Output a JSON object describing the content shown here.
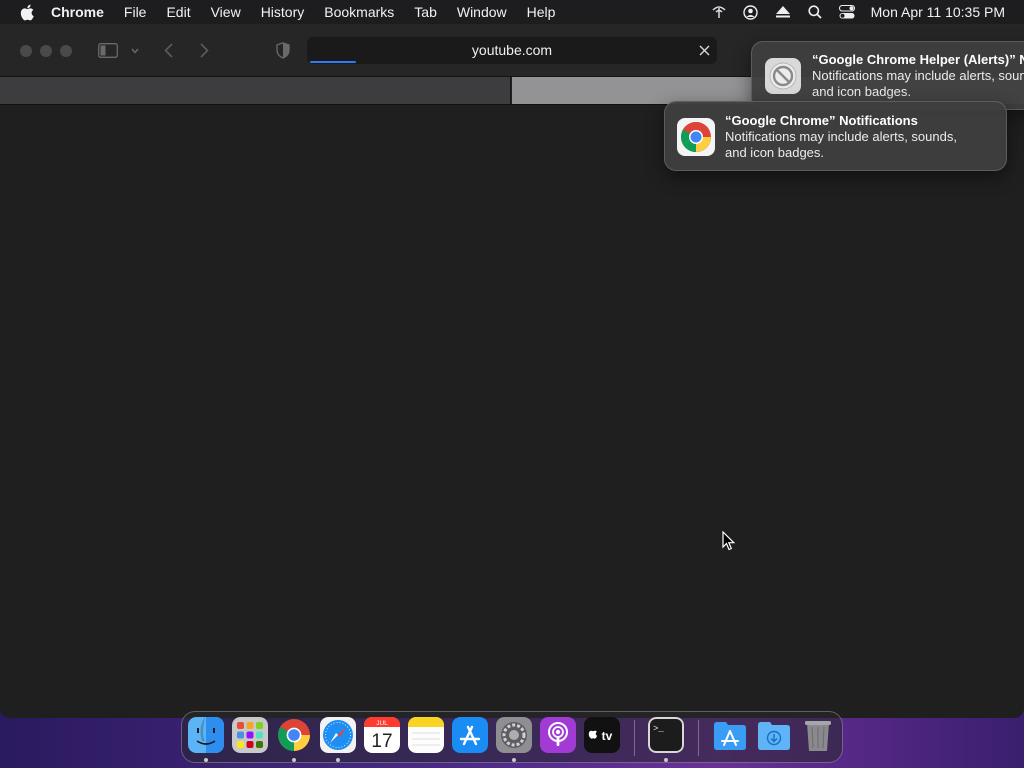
{
  "menubar": {
    "apple_icon": "apple-logo-icon",
    "app_name": "Chrome",
    "items": [
      "File",
      "Edit",
      "View",
      "History",
      "Bookmarks",
      "Tab",
      "Window",
      "Help"
    ],
    "status_icons": [
      "wifi-off-icon",
      "user-account-icon",
      "eject-icon",
      "search-icon",
      "control-center-icon"
    ],
    "clock": "Mon Apr 11  10:35 PM"
  },
  "browser": {
    "address_text": "youtube.com",
    "load_progress_icon": "loading-progress-bar",
    "icons": [
      "sidebar-icon",
      "chevron-down-icon",
      "back-icon",
      "forward-icon",
      "privacy-shield-icon",
      "close-icon"
    ]
  },
  "notifications": [
    {
      "title": "“Google Chrome Helper (Alerts)” N",
      "body_line1": "Notifications may include alerts, soun",
      "body_line2": "and icon badges.",
      "icon": "blocked-app-icon"
    },
    {
      "title": "“Google Chrome” Notifications",
      "body_line1": "Notifications may include alerts, sounds,",
      "body_line2": "and icon badges.",
      "icon": "chrome-icon"
    }
  ],
  "calendar": {
    "month": "JUL",
    "day": "17"
  },
  "appletv_label": "tv",
  "terminal_prompt": ">_",
  "dock": [
    "Finder",
    "Launchpad",
    "Google Chrome",
    "Safari",
    "Calendar",
    "Notes",
    "App Store",
    "System Preferences",
    "Podcasts",
    "Apple TV",
    "Terminal",
    "Applications",
    "Downloads",
    "Trash"
  ],
  "colors": {
    "menubar": "#1d1d1f",
    "window_bg": "#1f1f1f",
    "progress_accent": "#2f7bf5",
    "desktop_gradient_mid": "#6a2f9a"
  }
}
